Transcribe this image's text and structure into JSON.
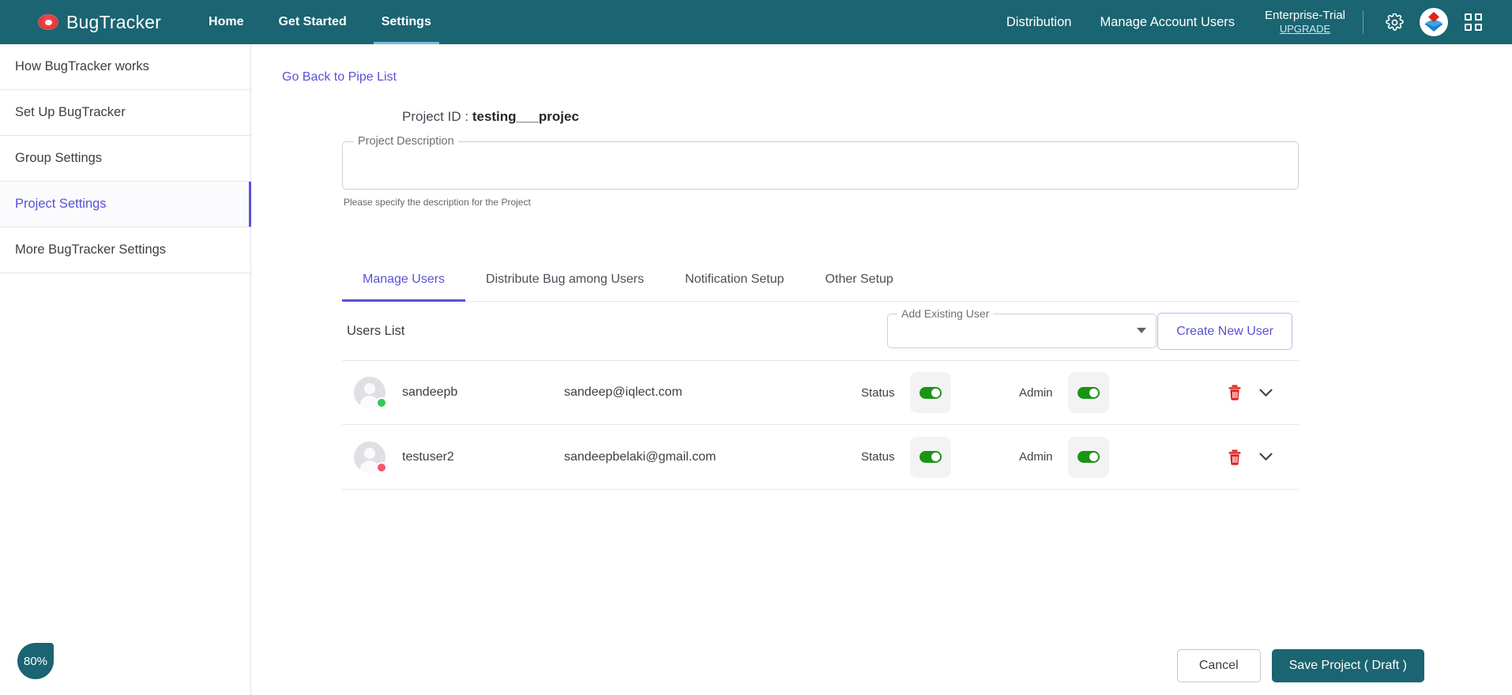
{
  "header": {
    "brand": "BugTracker",
    "brand_icon": "bug-eye-icon",
    "nav_left": [
      {
        "label": "Home",
        "active": false
      },
      {
        "label": "Get Started",
        "active": false
      },
      {
        "label": "Settings",
        "active": true
      }
    ],
    "nav_right": [
      {
        "label": "Distribution"
      },
      {
        "label": "Manage Account Users"
      }
    ],
    "plan": {
      "name": "Enterprise-Trial",
      "upgrade": "UPGRADE"
    },
    "icons": [
      "gear-icon",
      "account-logo",
      "apps-grid-icon"
    ],
    "colors": {
      "bar": "#1b6471",
      "active_underline": "#79bcd6"
    }
  },
  "sidebar": {
    "items": [
      {
        "label": "How BugTracker works",
        "active": false
      },
      {
        "label": "Set Up BugTracker",
        "active": false
      },
      {
        "label": "Group Settings",
        "active": false
      },
      {
        "label": "Project Settings",
        "active": true
      },
      {
        "label": "More BugTracker Settings",
        "active": false
      }
    ],
    "accent": "#5a51d6"
  },
  "main": {
    "back_link": "Go Back to Pipe List",
    "project_id_label": "Project ID :",
    "project_id_value": "testing___projec",
    "description": {
      "legend": "Project Description",
      "value": "",
      "placeholder": "",
      "help": "Please specify the description for the Project"
    },
    "tabs": [
      {
        "label": "Manage Users",
        "active": true
      },
      {
        "label": "Distribute Bug among Users",
        "active": false
      },
      {
        "label": "Notification Setup",
        "active": false
      },
      {
        "label": "Other Setup",
        "active": false
      }
    ],
    "users_section": {
      "title": "Users List",
      "add_existing_user": {
        "legend": "Add Existing User",
        "value": "",
        "caret": "chevron-down-icon"
      },
      "create_new_user_label": "Create New User",
      "status_label": "Status",
      "admin_label": "Admin",
      "rows": [
        {
          "name": "sandeepb",
          "email": "sandeep@iqlect.com",
          "presence_color": "#34c759",
          "status_label": "Status",
          "status_on": true,
          "admin_label": "Admin",
          "admin_on": true,
          "delete_icon": "trash-icon",
          "expand_icon": "chevron-down-icon"
        },
        {
          "name": "testuser2",
          "email": "sandeepbelaki@gmail.com",
          "presence_color": "#f4586a",
          "status_label": "Status",
          "status_on": true,
          "admin_label": "Admin",
          "admin_on": true,
          "delete_icon": "trash-icon",
          "expand_icon": "chevron-down-icon"
        }
      ]
    },
    "footer": {
      "cancel_label": "Cancel",
      "save_label": "Save Project ( Draft )"
    }
  },
  "zoom_badge": {
    "label": "80%"
  }
}
